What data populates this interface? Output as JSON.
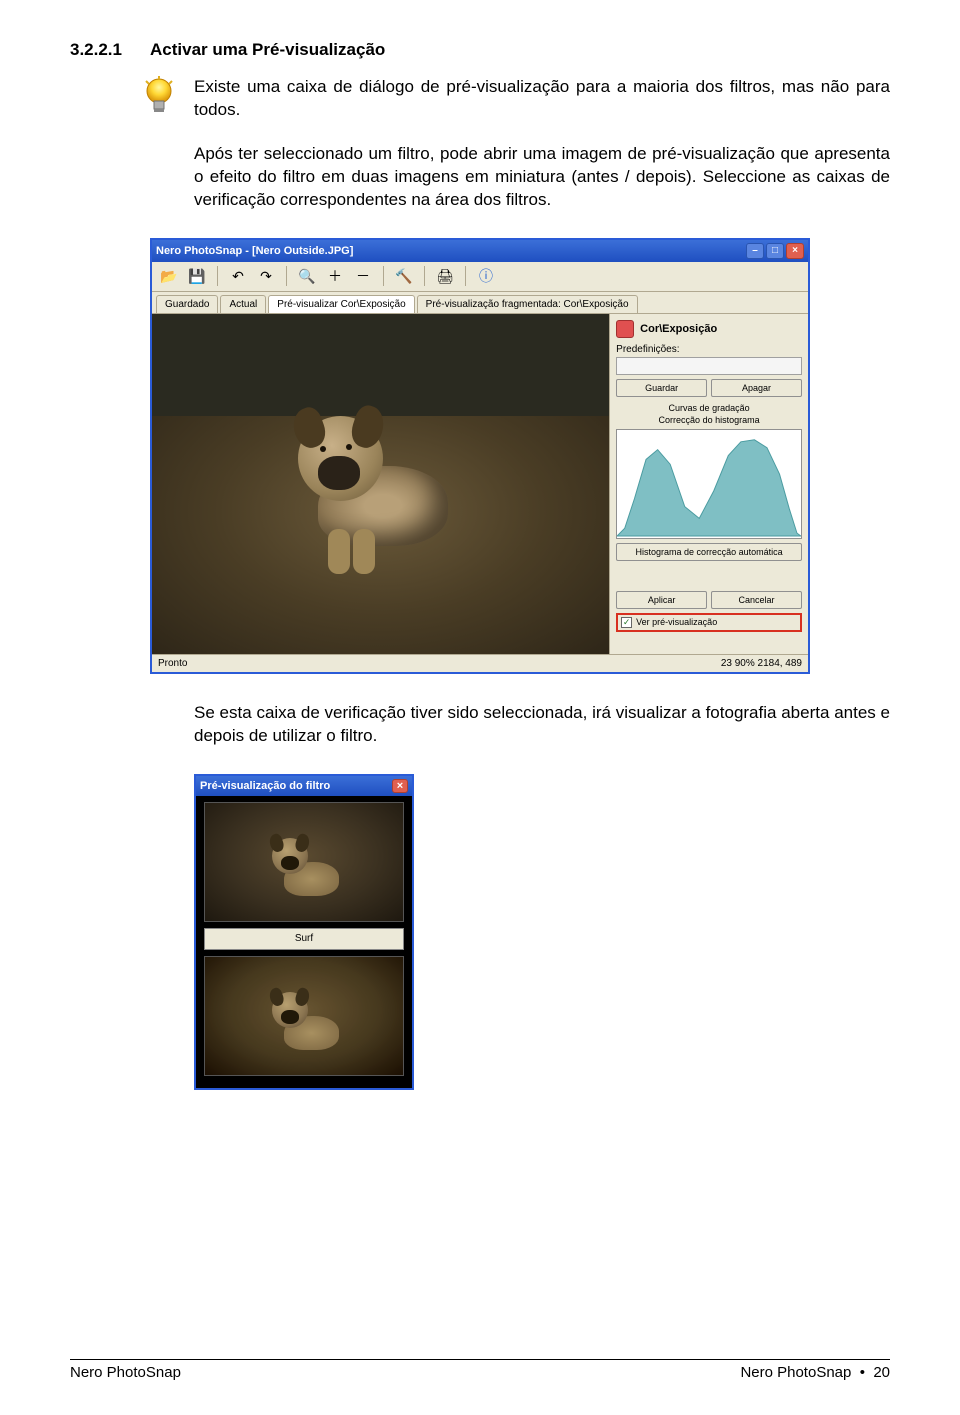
{
  "heading": {
    "num": "3.2.2.1",
    "text": "Activar uma Pré-visualização"
  },
  "tip": "Existe uma caixa de diálogo de pré-visualização para a maioria dos filtros, mas não para todos.",
  "para1": "Após ter seleccionado um filtro, pode abrir uma imagem de pré-visualização que apresenta o efeito do filtro em duas imagens em miniatura (antes / depois). Seleccione as caixas de verificação correspondentes na área dos filtros.",
  "app": {
    "title": "Nero PhotoSnap - [Nero Outside.JPG]",
    "tabs": {
      "t1": "Guardado",
      "t2": "Actual",
      "t3": "Pré-visualizar Cor\\Exposição",
      "t4": "Pré-visualização fragmentada: Cor\\Exposição"
    },
    "side": {
      "title": "Cor\\Exposição",
      "presets_label": "Predefinições:",
      "save": "Guardar",
      "delete": "Apagar",
      "curves": "Curvas de gradação",
      "histcorr": "Correcção do histograma",
      "autobtn": "Histograma de correcção automática",
      "apply": "Aplicar",
      "cancel": "Cancelar",
      "checkbox": "Ver pré-visualização"
    },
    "status": {
      "left": "Pronto",
      "right": "23 90%  2184, 489"
    }
  },
  "para2": "Se esta caixa de verificação tiver sido seleccionada, irá visualizar a fotografia aberta antes e depois de utilizar o filtro.",
  "preview": {
    "title": "Pré-visualização do filtro",
    "effect": "Surf"
  },
  "footer": {
    "left": "Nero PhotoSnap",
    "right": "Nero PhotoSnap",
    "page": "20",
    "bullet": "•"
  }
}
